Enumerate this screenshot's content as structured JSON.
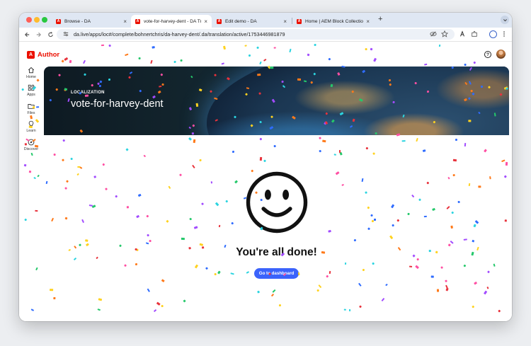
{
  "browser": {
    "tabs": [
      {
        "title": "Browse - DA",
        "active": false
      },
      {
        "title": "vote-for-harvey-dent - DA Tr",
        "active": true
      },
      {
        "title": "Edit demo - DA",
        "active": false
      },
      {
        "title": "Home | AEM Block Collection",
        "active": false
      }
    ],
    "new_tab_glyph": "+",
    "close_glyph": "×",
    "address": "da.live/apps/loc#/complete/bohnertchris/da-harvey-dent/.da/translation/active/1753446981879"
  },
  "app": {
    "brand": "Author",
    "accent_color": "#eb1000",
    "button_color": "#3b63fb"
  },
  "sidebar": {
    "items": [
      {
        "label": "Home",
        "icon": "home-icon"
      },
      {
        "label": "Apps",
        "icon": "apps-icon"
      },
      {
        "label": "Files",
        "icon": "folder-icon"
      },
      {
        "label": "Learn",
        "icon": "lightbulb-icon"
      },
      {
        "label": "Discover",
        "icon": "compass-icon"
      }
    ]
  },
  "hero": {
    "eyebrow": "LOCALIZATION",
    "title": "vote-for-harvey-dent"
  },
  "main": {
    "icon": "smiley-icon",
    "heading": "You're all done!",
    "button_label": "Go to dashboard"
  },
  "confetti_colors": [
    "#ff4fa3",
    "#2f6cff",
    "#ffd21f",
    "#25c86b",
    "#ff7a1a",
    "#a24bff",
    "#2bd4e0",
    "#e8323c"
  ]
}
